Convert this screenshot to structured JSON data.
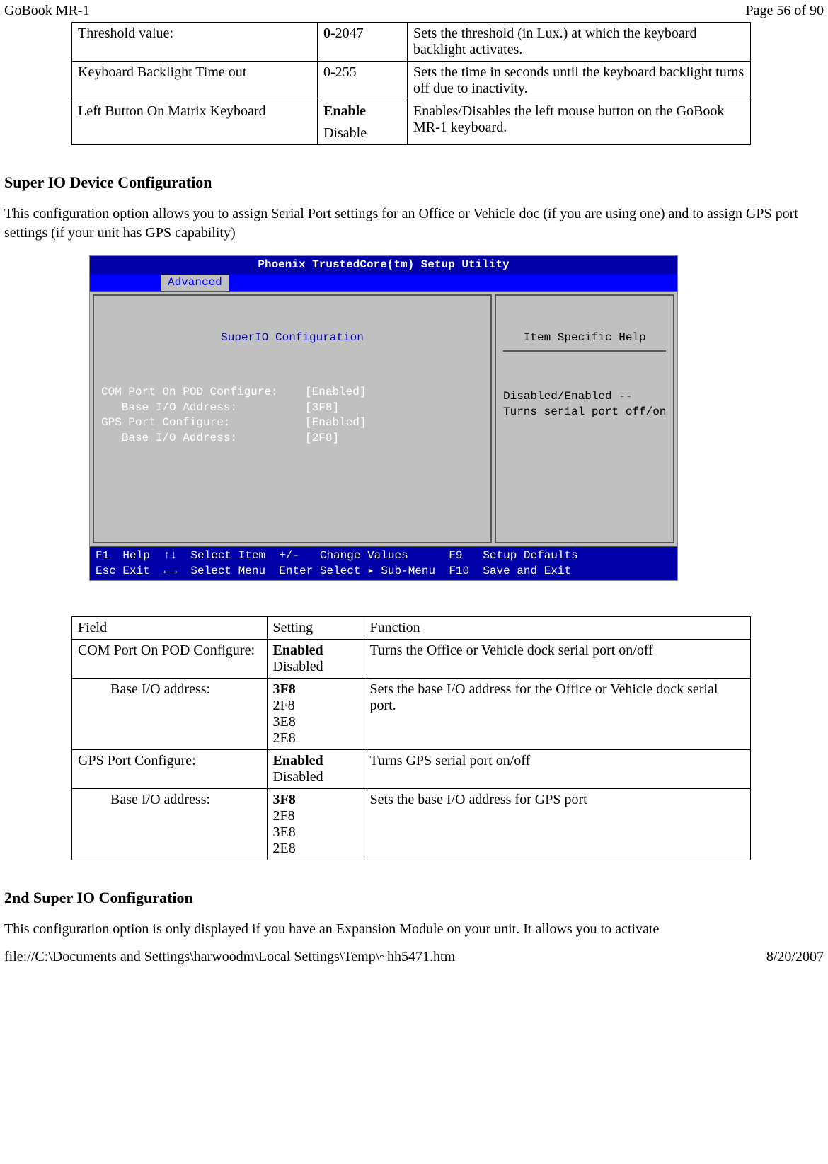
{
  "header": {
    "left": "GoBook MR-1",
    "right": "Page 56 of 90"
  },
  "footer": {
    "left": "file://C:\\Documents and Settings\\harwoodm\\Local Settings\\Temp\\~hh5471.htm",
    "right": "8/20/2007"
  },
  "table1": {
    "rows": [
      {
        "field": "Threshold value:",
        "setting_bold": "0",
        "setting_rest": "-2047",
        "func": "Sets the threshold (in Lux.) at which the keyboard backlight activates."
      },
      {
        "field": "Keyboard Backlight Time out",
        "setting_bold": "",
        "setting_rest": "0-255",
        "func": "Sets the time in seconds until the keyboard backlight turns off due to inactivity."
      },
      {
        "field": "Left Button On Matrix Keyboard",
        "setting_bold": "Enable",
        "setting_rest": "Disable",
        "func": "Enables/Disables the left mouse button on the GoBook MR-1 keyboard."
      }
    ]
  },
  "section1": {
    "heading": "Super IO Device Configuration",
    "paragraph": "This configuration option allows you to assign Serial Port settings for an Office or Vehicle doc (if you are using one) and to assign GPS port settings (if your unit has GPS capability)"
  },
  "bios": {
    "title": "Phoenix TrustedCore(tm) Setup Utility",
    "tab": "Advanced",
    "left_title": "SuperIO Configuration",
    "right_title": "Item Specific Help",
    "left_lines": "COM Port On POD Configure:    [Enabled]\n   Base I/O Address:          [3F8]\nGPS Port Configure:           [Enabled]\n   Base I/O Address:          [2F8]",
    "right_lines": "Disabled/Enabled --\nTurns serial port off/on",
    "bottom": "F1  Help  ↑↓  Select Item  +/-   Change Values      F9   Setup Defaults\nEsc Exit  ←→  Select Menu  Enter Select ▸ Sub-Menu  F10  Save and Exit"
  },
  "table2": {
    "header": {
      "c1": "Field",
      "c2": "Setting",
      "c3": "Function"
    },
    "rows": [
      {
        "indent": false,
        "field": "COM Port On POD Configure:",
        "setting_bold": "Enabled",
        "setting_rest": "Disabled",
        "func": "Turns the Office or Vehicle dock serial port on/off"
      },
      {
        "indent": true,
        "field": "Base I/O address:",
        "setting_bold": "3F8",
        "setting_rest": "2F8\n3E8\n2E8",
        "func": "Sets the base I/O address for the Office or Vehicle dock serial port."
      },
      {
        "indent": false,
        "field": "GPS Port Configure:",
        "setting_bold": "Enabled",
        "setting_rest": "Disabled",
        "func": "Turns GPS serial port on/off"
      },
      {
        "indent": true,
        "field": "Base I/O address:",
        "setting_bold": "3F8",
        "setting_rest": "2F8\n3E8\n2E8",
        "func": "Sets the base I/O address for GPS port"
      }
    ]
  },
  "section2": {
    "heading": "2nd Super IO Configuration",
    "paragraph": "This configuration option is only displayed if you have an Expansion Module on your unit.  It allows you to activate"
  }
}
